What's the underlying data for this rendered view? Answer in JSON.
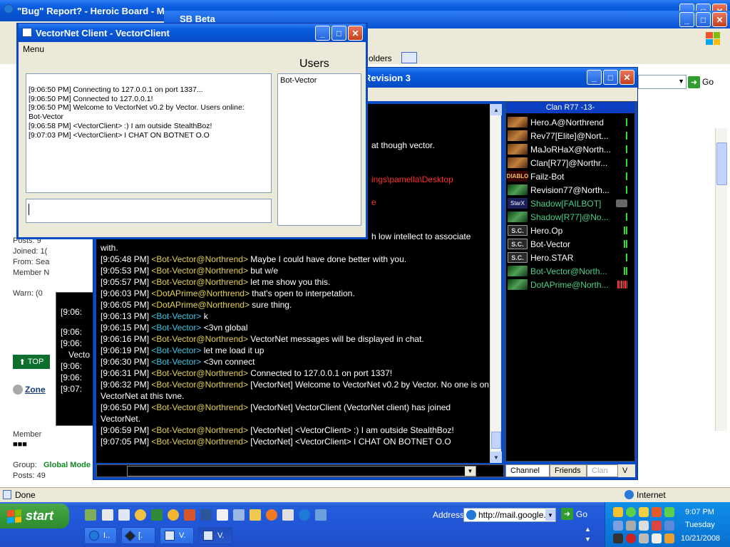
{
  "browser": {
    "title": "\"Bug\" Report? - Heroic Board - M",
    "menu_fragment": "olders",
    "go_label": "Go",
    "status": "Done",
    "zone": "Internet",
    "forum": {
      "posts_a": "Posts: 9",
      "joined": "Joined: 1(",
      "from": "From: Sea",
      "member_n": "Member N",
      "warn": "Warn: (0",
      "top_label": "TOP",
      "user": "Zone",
      "member": "Member",
      "group_label": "Group:",
      "group_value": "Global Mode",
      "posts_b": "Posts: 49"
    }
  },
  "sb_beta_title": "SB Beta",
  "stealthbot": {
    "title": "Revision 3",
    "lines": [
      {
        "ts": "",
        "user": "",
        "msg": "at though vector.",
        "color": "white"
      },
      {
        "ts": "",
        "user": "",
        "msg": "ings\\pamella\\Desktop",
        "color": "red"
      },
      {
        "ts": "",
        "user": "",
        "msg": "e",
        "color": "red"
      },
      {
        "ts": "",
        "user": "",
        "msg": "h low intellect to associate",
        "color": "white"
      },
      {
        "ts": "",
        "user": "",
        "msg": "with.",
        "color": "white"
      },
      {
        "ts": "[9:05:48 PM]",
        "user": "<Bot-Vector@Northrend>",
        "msg": "Maybe I could have done better with you.",
        "ucolor": "y"
      },
      {
        "ts": "[9:05:53 PM]",
        "user": "<Bot-Vector@Northrend>",
        "msg": "but w/e",
        "ucolor": "y"
      },
      {
        "ts": "[9:05:57 PM]",
        "user": "<Bot-Vector@Northrend>",
        "msg": "let me show you this.",
        "ucolor": "y"
      },
      {
        "ts": "[9:06:03 PM]",
        "user": "<DotAPrime@Northrend>",
        "msg": "that's open to interpetation.",
        "ucolor": "y"
      },
      {
        "ts": "[9:06:05 PM]",
        "user": "<DotAPrime@Northrend>",
        "msg": "sure thing.",
        "ucolor": "y"
      },
      {
        "ts": "[9:06:13 PM]",
        "user": "<Bot-Vector>",
        "msg": "k",
        "ucolor": "c"
      },
      {
        "ts": "[9:06:15 PM]",
        "user": "<Bot-Vector>",
        "msg": "<3vn global",
        "ucolor": "c"
      },
      {
        "ts": "[9:06:16 PM]",
        "user": "<Bot-Vector@Northrend>",
        "msg": "VectorNet messages will be displayed in chat.",
        "ucolor": "y"
      },
      {
        "ts": "[9:06:19 PM]",
        "user": "<Bot-Vector>",
        "msg": "let me load it up",
        "ucolor": "c"
      },
      {
        "ts": "[9:06:30 PM]",
        "user": "<Bot-Vector>",
        "msg": "<3vn connect",
        "ucolor": "c"
      },
      {
        "ts": "[9:06:31 PM]",
        "user": "<Bot-Vector@Northrend>",
        "msg": "Connected to 127.0.0.1 on port 1337!",
        "ucolor": "y"
      },
      {
        "ts": "[9:06:32 PM]",
        "user": "<Bot-Vector@Northrend>",
        "msg": "[VectorNet] Welcome to VectorNet v0.2 by Vector. No one is on VectorNet at this tvne.",
        "ucolor": "y",
        "wrap": true
      },
      {
        "ts": "[9:06:50 PM]",
        "user": "<Bot-Vector@Northrend>",
        "msg": "[VectorNet] VectorClient (VectorNet client) has joined VectorNet.",
        "ucolor": "y",
        "wrap": true
      },
      {
        "ts": "[9:06:59 PM]",
        "user": "<Bot-Vector@Northrend>",
        "msg": "[VectorNet] <VectorClient> :) I am outside StealthBoz!",
        "ucolor": "y"
      },
      {
        "ts": "[9:07:05 PM]",
        "user": "<Bot-Vector@Northrend>",
        "msg": "[VectorNet] <VectorClient> I CHAT ON BOTNET O.O",
        "ucolor": "y"
      }
    ],
    "channel": "Clan R77 -13-",
    "users": [
      {
        "name": "Hero.A@Northrend",
        "icon": "war",
        "color": "#ffffff",
        "lag": 1
      },
      {
        "name": "Rev77[Elite]@Nort...",
        "icon": "war",
        "color": "#ffffff",
        "lag": 1
      },
      {
        "name": "MaJoRHaX@North...",
        "icon": "war",
        "color": "#ffffff",
        "lag": 1
      },
      {
        "name": "Clan[R77]@Northr...",
        "icon": "war",
        "color": "#ffffff",
        "lag": 1
      },
      {
        "name": "Failz-Bot",
        "icon": "d2",
        "icon_text": "DIABLO",
        "color": "#ffffff",
        "lag": 1
      },
      {
        "name": "Revision77@North...",
        "icon": "w3",
        "color": "#ffffff",
        "lag": 1
      },
      {
        "name": "Shadow[FAILBOT]",
        "icon": "sx",
        "icon_text": "StarX",
        "color": "#4cd08c",
        "lag": 0,
        "plug": true
      },
      {
        "name": "Shadow[R77]@No...",
        "icon": "w3",
        "color": "#4cd08c",
        "lag": 1
      },
      {
        "name": "Hero.Op",
        "icon": "sc",
        "icon_text": "S.C.",
        "color": "#ffffff",
        "lag": 2
      },
      {
        "name": "Bot-Vector",
        "icon": "sc",
        "icon_text": "S.C.",
        "color": "#ffffff",
        "lag": 2
      },
      {
        "name": "Hero.STAR",
        "icon": "sc",
        "icon_text": "S.C.",
        "color": "#ffffff",
        "lag": 1
      },
      {
        "name": "Bot-Vector@North...",
        "icon": "w3",
        "color": "#4cd08c",
        "lag": 2
      },
      {
        "name": "DotAPrime@North...",
        "icon": "w3",
        "color": "#4cd08c",
        "lag": 6,
        "lag_red": true
      }
    ],
    "tabs": [
      "Channel",
      "Friends",
      "Clan",
      "V"
    ],
    "left_strip": [
      "[9:06:",
      "[9:06:",
      "[9:06:",
      "Vecto",
      "[9:06:",
      "[9:06:",
      "[9:07:"
    ]
  },
  "vectornet": {
    "title": "VectorNet Client - VectorClient",
    "menu": "Menu",
    "users_label": "Users",
    "log": [
      "[9:06:50 PM] Connecting to 127.0.0.1 on port 1337...",
      "[9:06:50 PM] Connected to 127.0.0.1!",
      "[9:06:50 PM] Welcome to VectorNet v0.2 by Vector. Users online:",
      "Bot-Vector",
      "[9:06:58 PM] <VectorClient> :) I am outside StealthBoz!",
      "[9:07:03 PM] <VectorClient> I CHAT ON BOTNET O.O"
    ],
    "users": [
      "Bot-Vector"
    ],
    "input_value": ""
  },
  "taskbar": {
    "start": "start",
    "address_label": "Address",
    "address_value": "http://mail.google.",
    "go": "Go",
    "buttons": [
      "I..",
      "[.",
      "V.",
      "V."
    ],
    "clock_time": "9:07 PM",
    "clock_day": "Tuesday",
    "clock_date": "10/21/2008"
  }
}
